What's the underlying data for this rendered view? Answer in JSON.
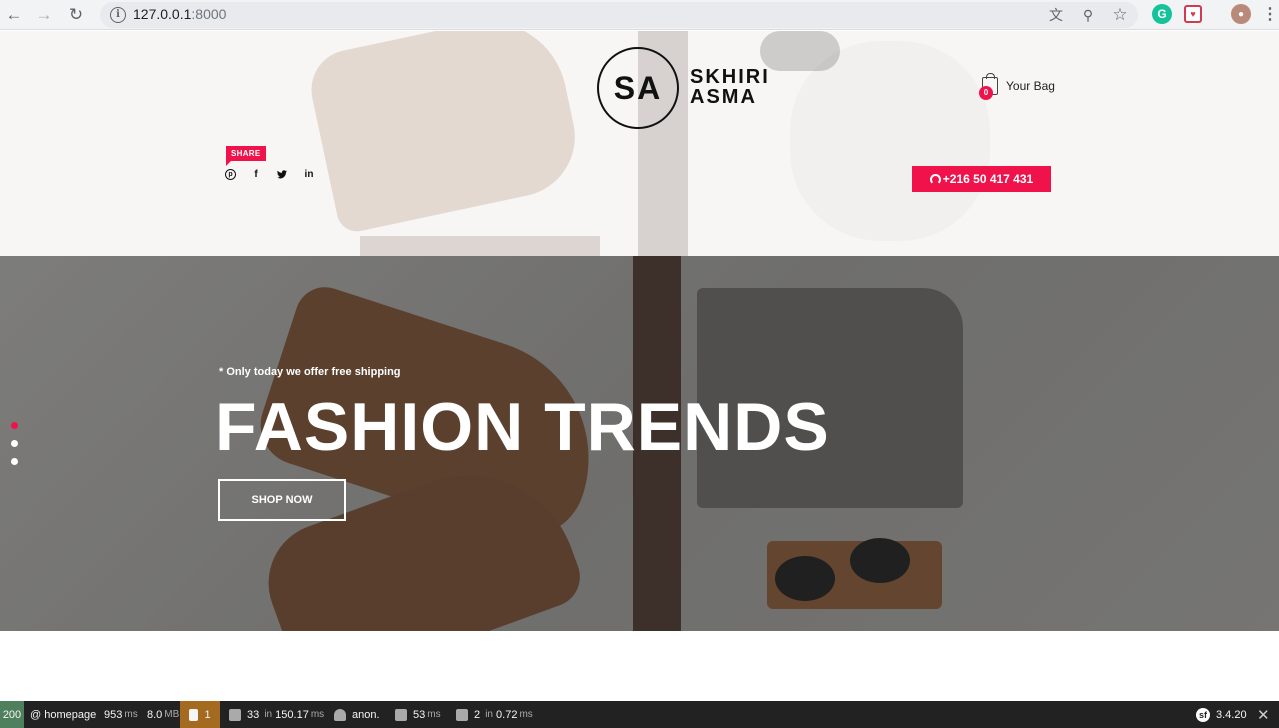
{
  "browser": {
    "url_host": "127.0.0.1",
    "url_port": ":8000",
    "back_icon": "←",
    "forward_icon": "→",
    "reload_icon": "↻",
    "info_icon": "i",
    "translate_icon": "文",
    "zoom_icon": "⚲",
    "star_icon": "☆",
    "grammarly_icon": "G",
    "pocket_icon": "♥",
    "profile_icon": "●",
    "menu_icon": "⋮"
  },
  "header": {
    "logo_mark": "SA",
    "logo_name_line1": "SKHIRI",
    "logo_name_line2": "ASMA",
    "bag_count": "0",
    "bag_label": "Your Bag",
    "share_label": "SHARE",
    "social": {
      "pinterest": "p",
      "facebook": "f",
      "twitter": "🐦",
      "linkedin": "in"
    },
    "phone": "+216 50 417 431"
  },
  "hero": {
    "subtitle": "* Only today we offer free shipping",
    "title": "FASHION TRENDS",
    "cta": "SHOP NOW",
    "slides_total": 3,
    "active_slide": 1
  },
  "debug_toolbar": {
    "status_code": "200",
    "route": "@ homepage",
    "time_value": "953",
    "time_unit": "ms",
    "memory_value": "8.0",
    "memory_unit": "MB",
    "warnings": "1",
    "twig_count": "33",
    "twig_in": "in",
    "twig_time": "150.17",
    "twig_unit": "ms",
    "user": "anon.",
    "render_time": "53",
    "render_unit": "ms",
    "db_count": "2",
    "db_in": "in",
    "db_time": "0.72",
    "db_unit": "ms",
    "version": "3.4.20",
    "close_icon": "✕"
  },
  "colors": {
    "accent": "#f0124b",
    "toolbar_bg": "#222222",
    "status_ok": "#4f805d",
    "warn": "#a46a1f"
  }
}
